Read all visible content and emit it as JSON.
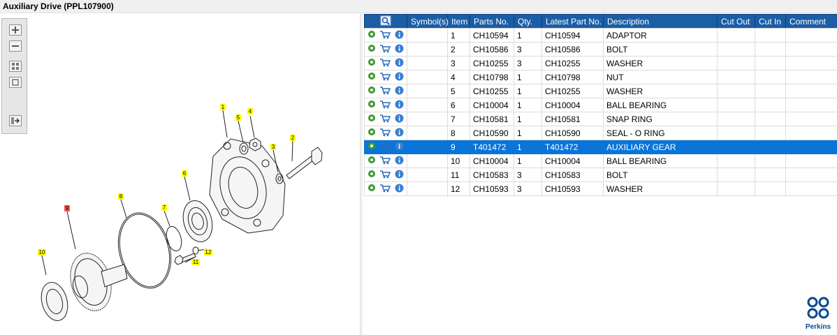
{
  "window": {
    "title": "Auxiliary Drive (PPL107900)"
  },
  "toolbar": {
    "buttons": [
      {
        "name": "zoom-in"
      },
      {
        "name": "zoom-out"
      },
      {
        "name": "fit-all"
      },
      {
        "name": "actual-size"
      },
      {
        "name": "export"
      }
    ]
  },
  "drawing": {
    "callouts": [
      {
        "label": "1",
        "highlighted": false
      },
      {
        "label": "2",
        "highlighted": false
      },
      {
        "label": "3",
        "highlighted": false
      },
      {
        "label": "4",
        "highlighted": false
      },
      {
        "label": "5",
        "highlighted": false
      },
      {
        "label": "6",
        "highlighted": false
      },
      {
        "label": "7",
        "highlighted": false
      },
      {
        "label": "8",
        "highlighted": false
      },
      {
        "label": "9",
        "highlighted": true
      },
      {
        "label": "10",
        "highlighted": false
      },
      {
        "label": "11",
        "highlighted": false
      },
      {
        "label": "12",
        "highlighted": false
      }
    ]
  },
  "table": {
    "headers": [
      "",
      "Symbol(s)",
      "Item",
      "Parts No.",
      "Qty.",
      "Latest Part No.",
      "Description",
      "Cut Out",
      "Cut In",
      "Comment"
    ],
    "rows": [
      {
        "item": "1",
        "part_no": "CH10594",
        "qty": "1",
        "latest": "CH10594",
        "desc": "ADAPTOR",
        "selected": false
      },
      {
        "item": "2",
        "part_no": "CH10586",
        "qty": "3",
        "latest": "CH10586",
        "desc": "BOLT",
        "selected": false
      },
      {
        "item": "3",
        "part_no": "CH10255",
        "qty": "3",
        "latest": "CH10255",
        "desc": "WASHER",
        "selected": false
      },
      {
        "item": "4",
        "part_no": "CH10798",
        "qty": "1",
        "latest": "CH10798",
        "desc": "NUT",
        "selected": false
      },
      {
        "item": "5",
        "part_no": "CH10255",
        "qty": "1",
        "latest": "CH10255",
        "desc": "WASHER",
        "selected": false
      },
      {
        "item": "6",
        "part_no": "CH10004",
        "qty": "1",
        "latest": "CH10004",
        "desc": "BALL BEARING",
        "selected": false
      },
      {
        "item": "7",
        "part_no": "CH10581",
        "qty": "1",
        "latest": "CH10581",
        "desc": "SNAP RING",
        "selected": false
      },
      {
        "item": "8",
        "part_no": "CH10590",
        "qty": "1",
        "latest": "CH10590",
        "desc": "SEAL - O RING",
        "selected": false
      },
      {
        "item": "9",
        "part_no": "T401472",
        "qty": "1",
        "latest": "T401472",
        "desc": "AUXILIARY GEAR",
        "selected": true
      },
      {
        "item": "10",
        "part_no": "CH10004",
        "qty": "1",
        "latest": "CH10004",
        "desc": "BALL BEARING",
        "selected": false
      },
      {
        "item": "11",
        "part_no": "CH10583",
        "qty": "3",
        "latest": "CH10583",
        "desc": "BOLT",
        "selected": false
      },
      {
        "item": "12",
        "part_no": "CH10593",
        "qty": "3",
        "latest": "CH10593",
        "desc": "WASHER",
        "selected": false
      }
    ]
  },
  "brand": {
    "name": "Perkins",
    "color": "#0a4a8f"
  },
  "colors": {
    "header_bg": "#1b5ea6",
    "selection": "#0a74d8",
    "callout": "#ffff00",
    "callout_highlight": "#ff5050"
  }
}
